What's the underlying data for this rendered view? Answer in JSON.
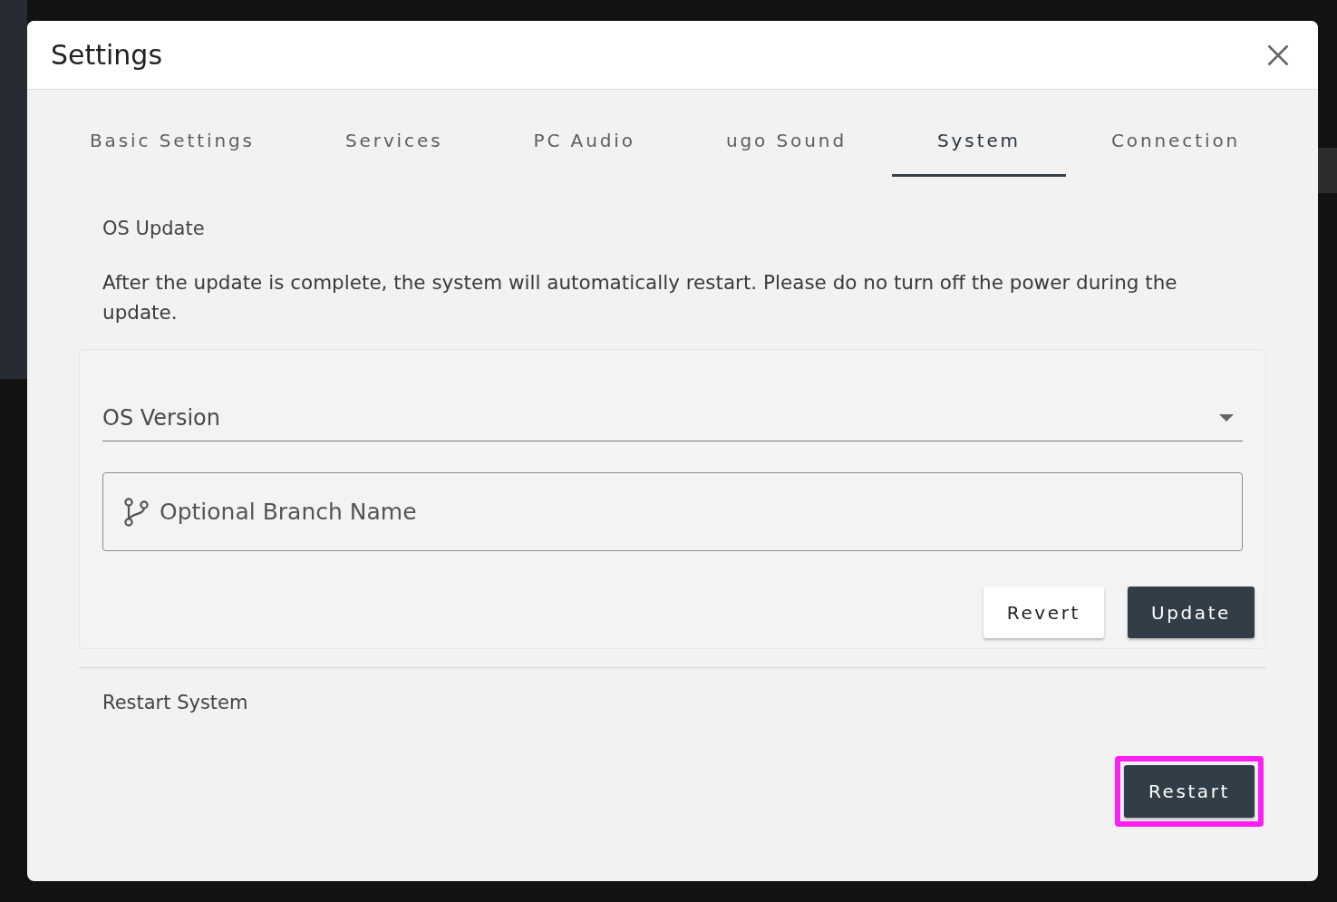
{
  "dialog": {
    "title": "Settings"
  },
  "tabs": [
    {
      "label": "Basic Settings",
      "selected": false
    },
    {
      "label": "Services",
      "selected": false
    },
    {
      "label": "PC Audio",
      "selected": false
    },
    {
      "label": "ugo Sound",
      "selected": false
    },
    {
      "label": "System",
      "selected": true
    },
    {
      "label": "Connection",
      "selected": false
    }
  ],
  "os_update": {
    "heading": "OS Update",
    "description": "After the update is complete, the system will automatically restart. Please do no turn off the power during the update.",
    "version_select": {
      "label": "OS Version"
    },
    "branch_field": {
      "placeholder": "Optional Branch Name"
    },
    "buttons": [
      {
        "label": "Revert",
        "kind": "secondary"
      },
      {
        "label": "Update",
        "kind": "primary"
      }
    ]
  },
  "restart_system": {
    "heading": "Restart System",
    "button": {
      "label": "Restart",
      "kind": "primary",
      "highlighted": true
    }
  }
}
